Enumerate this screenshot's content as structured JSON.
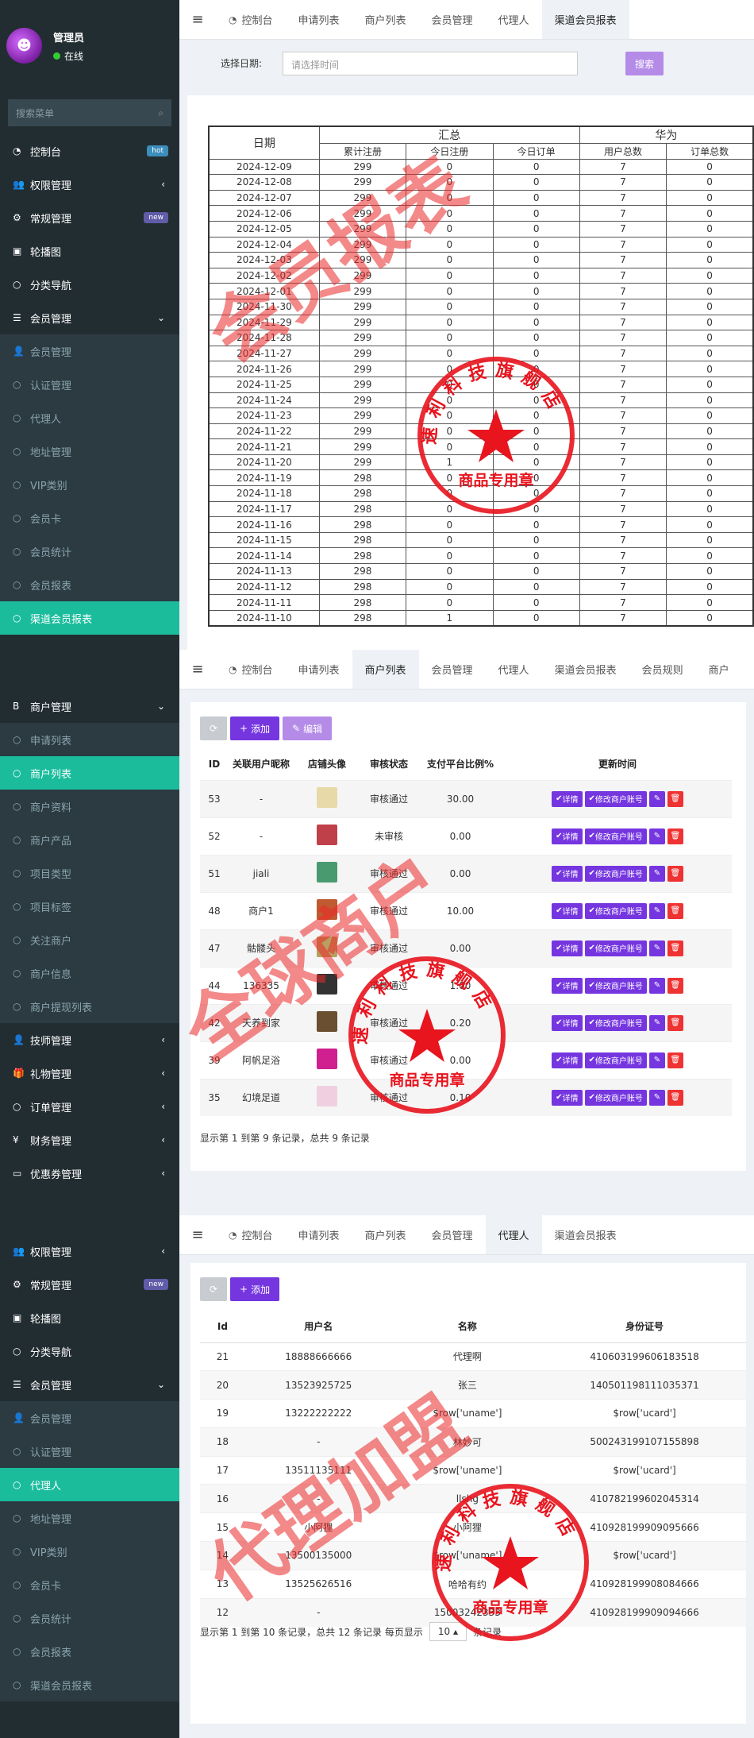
{
  "panel1": {
    "tabs": [
      {
        "icon": "dashboard-icon",
        "label": "控制台"
      },
      {
        "label": "申请列表"
      },
      {
        "label": "商户列表"
      },
      {
        "label": "会员管理"
      },
      {
        "label": "代理人"
      },
      {
        "label": "渠道会员报表"
      }
    ],
    "user": {
      "name": "管理员",
      "status": "在线"
    },
    "search_placeholder": "搜索菜单",
    "menu": [
      {
        "label": "控制台",
        "icon": "dashboard-icon",
        "badge": "hot",
        "type": "top"
      },
      {
        "label": "权限管理",
        "icon": "users-icon",
        "arrow": "‹",
        "type": "top"
      },
      {
        "label": "常规管理",
        "icon": "cogs-icon",
        "badge": "new",
        "type": "top"
      },
      {
        "label": "轮播图",
        "icon": "image-icon",
        "type": "top"
      },
      {
        "label": "分类导航",
        "icon": "circle-icon",
        "type": "top"
      },
      {
        "label": "会员管理",
        "icon": "list-icon",
        "arrow": "⌄",
        "type": "top"
      },
      {
        "label": "会员管理",
        "icon": "user-icon",
        "type": "sub"
      },
      {
        "label": "认证管理",
        "icon": "circle-icon",
        "type": "sub"
      },
      {
        "label": "代理人",
        "icon": "circle-icon",
        "type": "sub"
      },
      {
        "label": "地址管理",
        "icon": "circle-icon",
        "type": "sub"
      },
      {
        "label": "VIP类别",
        "icon": "circle-icon",
        "type": "sub"
      },
      {
        "label": "会员卡",
        "icon": "circle-icon",
        "type": "sub"
      },
      {
        "label": "会员统计",
        "icon": "circle-icon",
        "type": "sub"
      },
      {
        "label": "会员报表",
        "icon": "circle-icon",
        "type": "sub"
      },
      {
        "label": "渠道会员报表",
        "icon": "circle-icon",
        "type": "active"
      }
    ],
    "date_label": "选择日期:",
    "date_placeholder": "请选择时间",
    "search_button": "搜索",
    "report": {
      "h_date": "日期",
      "h_sum": "汇总",
      "h_huawei": "华为",
      "sub": [
        "累计注册",
        "今日注册",
        "今日订单",
        "用户总数",
        "订单总数"
      ],
      "rows": [
        [
          "2024-12-09",
          "299",
          "0",
          "0",
          "7",
          "0"
        ],
        [
          "2024-12-08",
          "299",
          "0",
          "0",
          "7",
          "0"
        ],
        [
          "2024-12-07",
          "299",
          "0",
          "0",
          "7",
          "0"
        ],
        [
          "2024-12-06",
          "299",
          "0",
          "0",
          "7",
          "0"
        ],
        [
          "2024-12-05",
          "299",
          "0",
          "0",
          "7",
          "0"
        ],
        [
          "2024-12-04",
          "299",
          "0",
          "0",
          "7",
          "0"
        ],
        [
          "2024-12-03",
          "299",
          "0",
          "0",
          "7",
          "0"
        ],
        [
          "2024-12-02",
          "299",
          "0",
          "0",
          "7",
          "0"
        ],
        [
          "2024-12-01",
          "299",
          "0",
          "0",
          "7",
          "0"
        ],
        [
          "2024-11-30",
          "299",
          "0",
          "0",
          "7",
          "0"
        ],
        [
          "2024-11-29",
          "299",
          "0",
          "0",
          "7",
          "0"
        ],
        [
          "2024-11-28",
          "299",
          "0",
          "0",
          "7",
          "0"
        ],
        [
          "2024-11-27",
          "299",
          "0",
          "0",
          "7",
          "0"
        ],
        [
          "2024-11-26",
          "299",
          "0",
          "0",
          "7",
          "0"
        ],
        [
          "2024-11-25",
          "299",
          "0",
          "0",
          "7",
          "0"
        ],
        [
          "2024-11-24",
          "299",
          "0",
          "0",
          "7",
          "0"
        ],
        [
          "2024-11-23",
          "299",
          "0",
          "0",
          "7",
          "0"
        ],
        [
          "2024-11-22",
          "299",
          "0",
          "0",
          "7",
          "0"
        ],
        [
          "2024-11-21",
          "299",
          "0",
          "0",
          "7",
          "0"
        ],
        [
          "2024-11-20",
          "299",
          "1",
          "0",
          "7",
          "0"
        ],
        [
          "2024-11-19",
          "298",
          "0",
          "0",
          "7",
          "0"
        ],
        [
          "2024-11-18",
          "298",
          "0",
          "0",
          "7",
          "0"
        ],
        [
          "2024-11-17",
          "298",
          "0",
          "0",
          "7",
          "0"
        ],
        [
          "2024-11-16",
          "298",
          "0",
          "0",
          "7",
          "0"
        ],
        [
          "2024-11-15",
          "298",
          "0",
          "0",
          "7",
          "0"
        ],
        [
          "2024-11-14",
          "298",
          "0",
          "0",
          "7",
          "0"
        ],
        [
          "2024-11-13",
          "298",
          "0",
          "0",
          "7",
          "0"
        ],
        [
          "2024-11-12",
          "298",
          "0",
          "0",
          "7",
          "0"
        ],
        [
          "2024-11-11",
          "298",
          "0",
          "0",
          "7",
          "0"
        ],
        [
          "2024-11-10",
          "298",
          "1",
          "0",
          "7",
          "0"
        ]
      ]
    },
    "watermark": "会员报表"
  },
  "panel2": {
    "tabs": [
      {
        "icon": "dashboard-icon",
        "label": "控制台"
      },
      {
        "label": "申请列表"
      },
      {
        "label": "商户列表"
      },
      {
        "label": "会员管理"
      },
      {
        "label": "代理人"
      },
      {
        "label": "渠道会员报表"
      },
      {
        "label": "会员规则"
      },
      {
        "label": "商户"
      }
    ],
    "menu": [
      {
        "label": "商户管理",
        "icon": "bold-b-icon",
        "arrow": "⌄",
        "type": "top"
      },
      {
        "label": "申请列表",
        "icon": "circle-icon",
        "type": "sub"
      },
      {
        "label": "商户列表",
        "icon": "circle-icon",
        "type": "active"
      },
      {
        "label": "商户资料",
        "icon": "circle-icon",
        "type": "sub"
      },
      {
        "label": "商户产品",
        "icon": "circle-icon",
        "type": "sub"
      },
      {
        "label": "项目类型",
        "icon": "circle-icon",
        "type": "sub"
      },
      {
        "label": "项目标签",
        "icon": "circle-icon",
        "type": "sub"
      },
      {
        "label": "关注商户",
        "icon": "circle-icon",
        "type": "sub"
      },
      {
        "label": "商户信息",
        "icon": "circle-icon",
        "type": "sub"
      },
      {
        "label": "商户提现列表",
        "icon": "circle-icon",
        "type": "sub"
      },
      {
        "label": "技师管理",
        "icon": "user-icon",
        "arrow": "‹",
        "type": "top"
      },
      {
        "label": "礼物管理",
        "icon": "gift-icon",
        "arrow": "‹",
        "type": "top"
      },
      {
        "label": "订单管理",
        "icon": "circle-icon",
        "arrow": "‹",
        "type": "top"
      },
      {
        "label": "财务管理",
        "icon": "yen-icon",
        "arrow": "‹",
        "type": "top"
      },
      {
        "label": "优惠券管理",
        "icon": "ticket-icon",
        "arrow": "‹",
        "type": "top"
      }
    ],
    "add_button": "添加",
    "edit_button": "编辑",
    "headers": [
      "ID",
      "关联用户昵称",
      "店铺头像",
      "审核状态",
      "支付平台比例%",
      "更新时间"
    ],
    "op_detail": "详情",
    "op_modify": "修改商户账号",
    "rows": [
      {
        "id": "53",
        "nick": "-",
        "thumb": "#e8d9a8",
        "status": "审核通过",
        "ratio": "30.00"
      },
      {
        "id": "52",
        "nick": "-",
        "thumb": "#c0404a",
        "status": "未审核",
        "ratio": "0.00"
      },
      {
        "id": "51",
        "nick": "jiali",
        "thumb": "#4a9a70",
        "status": "审核通过",
        "ratio": "0.00"
      },
      {
        "id": "48",
        "nick": "商户1",
        "thumb": "#c05a30",
        "status": "审核通过",
        "ratio": "10.00"
      },
      {
        "id": "47",
        "nick": "骷髅头",
        "thumb": "#b8a060",
        "status": "审核通过",
        "ratio": "0.00"
      },
      {
        "id": "44",
        "nick": "136335",
        "thumb": "#333333",
        "status": "审核通过",
        "ratio": "1.00"
      },
      {
        "id": "42",
        "nick": "天养到家",
        "thumb": "#6a5030",
        "status": "审核通过",
        "ratio": "0.20"
      },
      {
        "id": "39",
        "nick": "阿帆足浴",
        "thumb": "#d02090",
        "status": "审核通过",
        "ratio": "0.00"
      },
      {
        "id": "35",
        "nick": "幻境足道",
        "thumb": "#f0d0e0",
        "status": "审核通过",
        "ratio": "0.10"
      }
    ],
    "footer": "显示第 1 到第 9 条记录，总共 9 条记录",
    "watermark": "全球商户"
  },
  "panel3": {
    "tabs": [
      {
        "icon": "dashboard-icon",
        "label": "控制台"
      },
      {
        "label": "申请列表"
      },
      {
        "label": "商户列表"
      },
      {
        "label": "会员管理"
      },
      {
        "label": "代理人"
      },
      {
        "label": "渠道会员报表"
      }
    ],
    "menu": [
      {
        "label": "权限管理",
        "icon": "users-icon",
        "arrow": "‹",
        "type": "top"
      },
      {
        "label": "常规管理",
        "icon": "cogs-icon",
        "badge": "new",
        "type": "top"
      },
      {
        "label": "轮播图",
        "icon": "image-icon",
        "type": "top"
      },
      {
        "label": "分类导航",
        "icon": "circle-icon",
        "type": "top"
      },
      {
        "label": "会员管理",
        "icon": "list-icon",
        "arrow": "⌄",
        "type": "top"
      },
      {
        "label": "会员管理",
        "icon": "user-icon",
        "type": "sub"
      },
      {
        "label": "认证管理",
        "icon": "circle-icon",
        "type": "sub"
      },
      {
        "label": "代理人",
        "icon": "circle-icon",
        "type": "active"
      },
      {
        "label": "地址管理",
        "icon": "circle-icon",
        "type": "sub"
      },
      {
        "label": "VIP类别",
        "icon": "circle-icon",
        "type": "sub"
      },
      {
        "label": "会员卡",
        "icon": "circle-icon",
        "type": "sub"
      },
      {
        "label": "会员统计",
        "icon": "circle-icon",
        "type": "sub"
      },
      {
        "label": "会员报表",
        "icon": "circle-icon",
        "type": "sub"
      },
      {
        "label": "渠道会员报表",
        "icon": "circle-icon",
        "type": "sub"
      }
    ],
    "add_button": "添加",
    "headers": [
      "Id",
      "用户名",
      "名称",
      "身份证号"
    ],
    "rows": [
      [
        "21",
        "18888666666",
        "代理啊",
        "410603199606183518"
      ],
      [
        "20",
        "13523925725",
        "张三",
        "140501198111035371"
      ],
      [
        "19",
        "13222222222",
        "$row['uname']",
        "$row['ucard']"
      ],
      [
        "18",
        "-",
        "林妙可",
        "500243199107155898"
      ],
      [
        "17",
        "13511135111",
        "$row['uname']",
        "$row['ucard']"
      ],
      [
        "16",
        "-",
        "llshg",
        "410782199602045314"
      ],
      [
        "15",
        "小阿狸",
        "小阿狸",
        "410928199909095666"
      ],
      [
        "14",
        "13500135000",
        "$row['uname']",
        "$row['ucard']"
      ],
      [
        "13",
        "13525626516",
        "哈哈有约",
        "410928199908084666"
      ],
      [
        "12",
        "-",
        "15003242333",
        "410928199909094666"
      ]
    ],
    "footer": "显示第 1 到第 10 条记录，总共 12 条记录 每页显示",
    "page_size": "10",
    "footer_suffix": "条记录",
    "watermark": "代理加盟"
  },
  "stamp": {
    "text": "速利科技旗舰店",
    "sub": "商品专用章",
    "color": "#e8141e"
  }
}
